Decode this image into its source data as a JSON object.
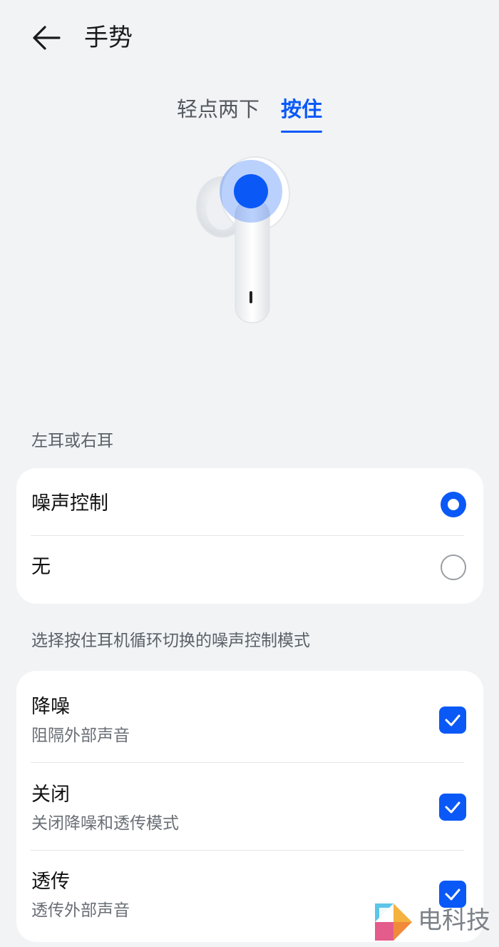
{
  "header": {
    "title": "手势",
    "back_icon": "back-arrow-icon"
  },
  "tabs": [
    {
      "label": "轻点两下",
      "active": false
    },
    {
      "label": "按住",
      "active": true
    }
  ],
  "earbud_image": {
    "icon": "earbud-icon",
    "highlight_color": "#0a59f7"
  },
  "section_ear": {
    "label": "左耳或右耳"
  },
  "ear_options": [
    {
      "label": "噪声控制",
      "selected": true
    },
    {
      "label": "无",
      "selected": false
    }
  ],
  "section_modes": {
    "label": "选择按住耳机循环切换的噪声控制模式"
  },
  "modes": [
    {
      "title": "降噪",
      "subtitle": "阻隔外部声音",
      "checked": true
    },
    {
      "title": "关闭",
      "subtitle": "关闭降噪和透传模式",
      "checked": true
    },
    {
      "title": "透传",
      "subtitle": "透传外部声音",
      "checked": true
    }
  ],
  "watermark": {
    "text": "电科技"
  },
  "colors": {
    "accent": "#0a59f7",
    "background": "#f1f3f5",
    "card": "#ffffff"
  }
}
